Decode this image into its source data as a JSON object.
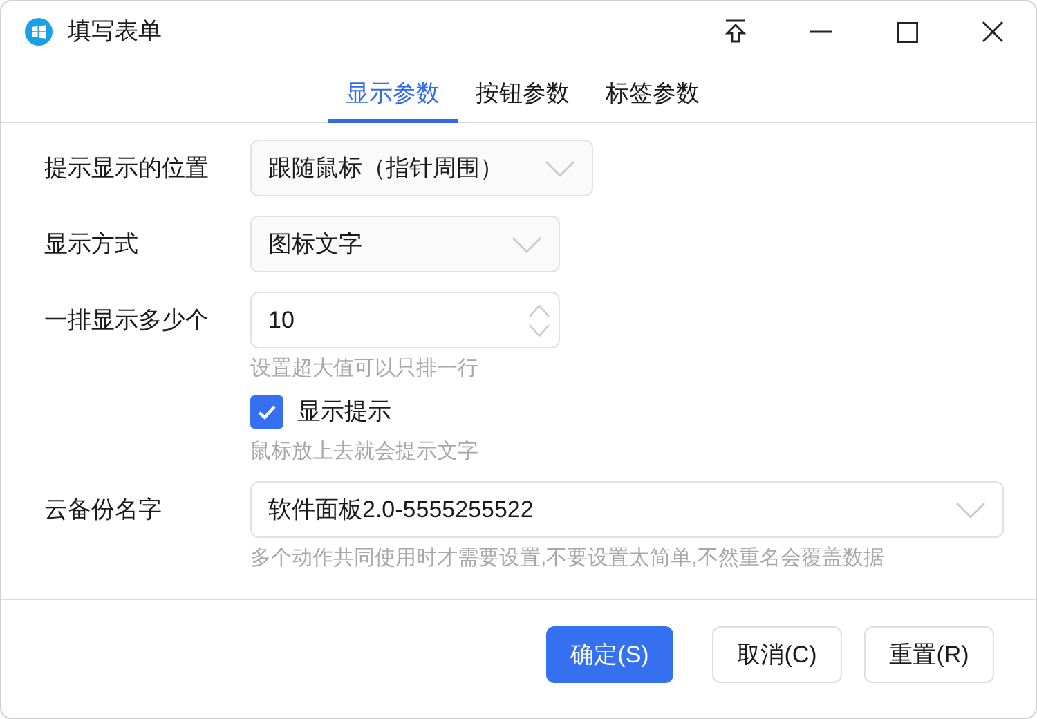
{
  "window": {
    "title": "填写表单"
  },
  "tabs": [
    {
      "label": "显示参数",
      "selected": true
    },
    {
      "label": "按钮参数",
      "selected": false
    },
    {
      "label": "标签参数",
      "selected": false
    }
  ],
  "fields": [
    {
      "kind": "dropdown",
      "label": "提示显示的位置",
      "value": "跟随鼠标（指针周围）"
    },
    {
      "kind": "dropdown",
      "label": "显示方式",
      "value": "图标文字"
    },
    {
      "kind": "spinner",
      "label": "一排显示多少个",
      "value": "10",
      "hint": "设置超大值可以只排一行"
    },
    {
      "kind": "checkbox",
      "label": "显示提示",
      "checked": true,
      "hint": "鼠标放上去就会提示文字"
    },
    {
      "kind": "dropdown",
      "label": "云备份名字",
      "value": "软件面板2.0-5555255522",
      "hint": "多个动作共同使用时才需要设置,不要设置太简单,不然重名会覆盖数据"
    }
  ],
  "buttons": [
    {
      "label": "确定(S)",
      "primary": true
    },
    {
      "label": "取消(C)",
      "primary": false
    },
    {
      "label": "重置(R)",
      "primary": false
    }
  ]
}
